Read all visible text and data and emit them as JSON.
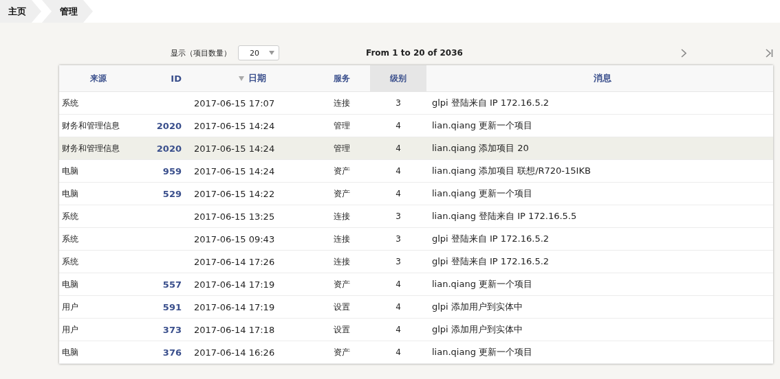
{
  "breadcrumb": [
    {
      "label": "主页"
    },
    {
      "label": "管理"
    }
  ],
  "pager": {
    "display_label": "显示（项目数量）",
    "page_size": "20",
    "range": "From 1 to 20 of 2036"
  },
  "table": {
    "columns": [
      {
        "label": "来源",
        "sorted": false,
        "highlighted": false
      },
      {
        "label": "ID",
        "sorted": false,
        "highlighted": false
      },
      {
        "label": "日期",
        "sorted": true,
        "highlighted": false
      },
      {
        "label": "服务",
        "sorted": false,
        "highlighted": false
      },
      {
        "label": "级别",
        "sorted": false,
        "highlighted": true
      },
      {
        "label": "消息",
        "sorted": false,
        "highlighted": false
      }
    ],
    "rows": [
      {
        "source": "系统",
        "id": "",
        "date": "2017-06-15 17:07",
        "service": "连接",
        "level": "3",
        "message": "glpi 登陆来自 IP 172.16.5.2",
        "selected": false
      },
      {
        "source": "财务和管理信息",
        "id": "2020",
        "date": "2017-06-15 14:24",
        "service": "管理",
        "level": "4",
        "message": "lian.qiang 更新一个项目",
        "selected": false
      },
      {
        "source": "财务和管理信息",
        "id": "2020",
        "date": "2017-06-15 14:24",
        "service": "管理",
        "level": "4",
        "message": "lian.qiang 添加项目 20",
        "selected": true
      },
      {
        "source": "电脑",
        "id": "959",
        "date": "2017-06-15 14:24",
        "service": "资产",
        "level": "4",
        "message": "lian.qiang 添加项目 联想/R720-15IKB",
        "selected": false
      },
      {
        "source": "电脑",
        "id": "529",
        "date": "2017-06-15 14:22",
        "service": "资产",
        "level": "4",
        "message": "lian.qiang 更新一个项目",
        "selected": false
      },
      {
        "source": "系统",
        "id": "",
        "date": "2017-06-15 13:25",
        "service": "连接",
        "level": "3",
        "message": "lian.qiang 登陆来自 IP 172.16.5.5",
        "selected": false
      },
      {
        "source": "系统",
        "id": "",
        "date": "2017-06-15 09:43",
        "service": "连接",
        "level": "3",
        "message": "glpi 登陆来自 IP 172.16.5.2",
        "selected": false
      },
      {
        "source": "系统",
        "id": "",
        "date": "2017-06-14 17:26",
        "service": "连接",
        "level": "3",
        "message": "glpi 登陆来自 IP 172.16.5.2",
        "selected": false
      },
      {
        "source": "电脑",
        "id": "557",
        "date": "2017-06-14 17:19",
        "service": "资产",
        "level": "4",
        "message": "lian.qiang 更新一个项目",
        "selected": false
      },
      {
        "source": "用户",
        "id": "591",
        "date": "2017-06-14 17:19",
        "service": "设置",
        "level": "4",
        "message": "glpi 添加用户到实体中",
        "selected": false
      },
      {
        "source": "用户",
        "id": "373",
        "date": "2017-06-14 17:18",
        "service": "设置",
        "level": "4",
        "message": "glpi 添加用户到实体中",
        "selected": false
      },
      {
        "source": "电脑",
        "id": "376",
        "date": "2017-06-14 16:26",
        "service": "资产",
        "level": "4",
        "message": "lian.qiang 更新一个项目",
        "selected": false
      }
    ]
  }
}
